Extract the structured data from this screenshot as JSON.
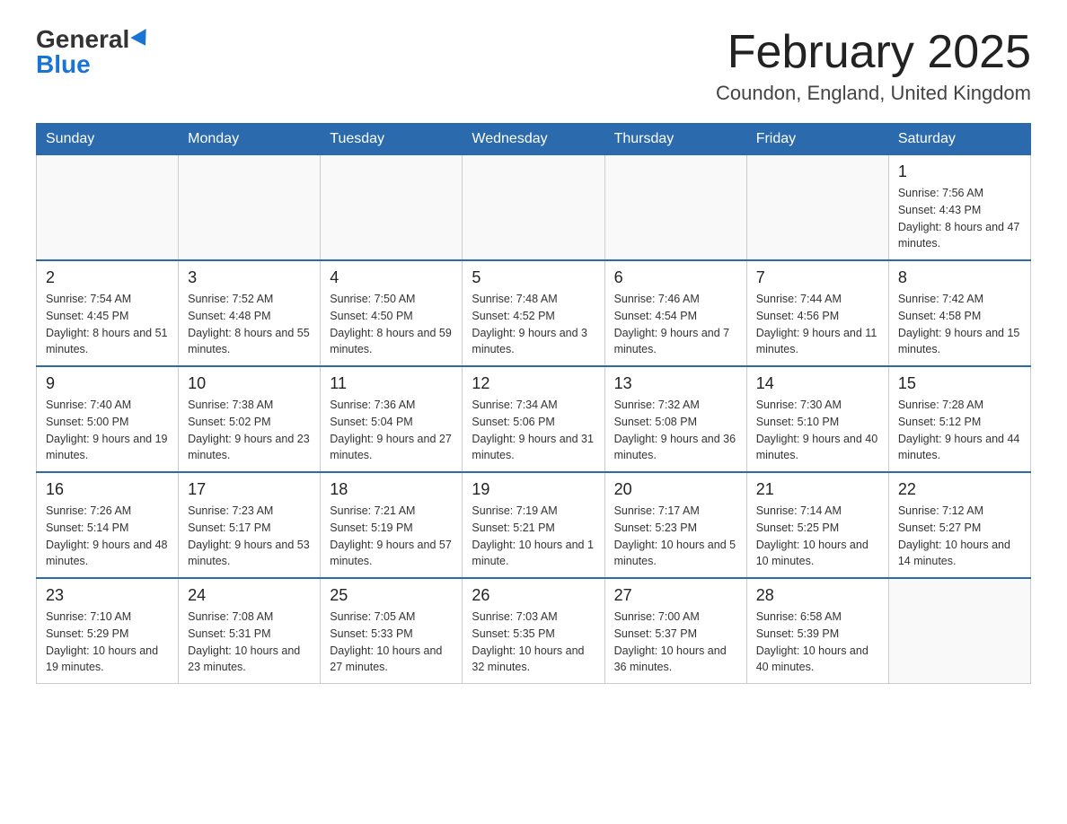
{
  "logo": {
    "general": "General",
    "blue": "Blue"
  },
  "header": {
    "title": "February 2025",
    "location": "Coundon, England, United Kingdom"
  },
  "weekdays": [
    "Sunday",
    "Monday",
    "Tuesday",
    "Wednesday",
    "Thursday",
    "Friday",
    "Saturday"
  ],
  "weeks": [
    [
      {
        "day": "",
        "info": ""
      },
      {
        "day": "",
        "info": ""
      },
      {
        "day": "",
        "info": ""
      },
      {
        "day": "",
        "info": ""
      },
      {
        "day": "",
        "info": ""
      },
      {
        "day": "",
        "info": ""
      },
      {
        "day": "1",
        "info": "Sunrise: 7:56 AM\nSunset: 4:43 PM\nDaylight: 8 hours and 47 minutes."
      }
    ],
    [
      {
        "day": "2",
        "info": "Sunrise: 7:54 AM\nSunset: 4:45 PM\nDaylight: 8 hours and 51 minutes."
      },
      {
        "day": "3",
        "info": "Sunrise: 7:52 AM\nSunset: 4:48 PM\nDaylight: 8 hours and 55 minutes."
      },
      {
        "day": "4",
        "info": "Sunrise: 7:50 AM\nSunset: 4:50 PM\nDaylight: 8 hours and 59 minutes."
      },
      {
        "day": "5",
        "info": "Sunrise: 7:48 AM\nSunset: 4:52 PM\nDaylight: 9 hours and 3 minutes."
      },
      {
        "day": "6",
        "info": "Sunrise: 7:46 AM\nSunset: 4:54 PM\nDaylight: 9 hours and 7 minutes."
      },
      {
        "day": "7",
        "info": "Sunrise: 7:44 AM\nSunset: 4:56 PM\nDaylight: 9 hours and 11 minutes."
      },
      {
        "day": "8",
        "info": "Sunrise: 7:42 AM\nSunset: 4:58 PM\nDaylight: 9 hours and 15 minutes."
      }
    ],
    [
      {
        "day": "9",
        "info": "Sunrise: 7:40 AM\nSunset: 5:00 PM\nDaylight: 9 hours and 19 minutes."
      },
      {
        "day": "10",
        "info": "Sunrise: 7:38 AM\nSunset: 5:02 PM\nDaylight: 9 hours and 23 minutes."
      },
      {
        "day": "11",
        "info": "Sunrise: 7:36 AM\nSunset: 5:04 PM\nDaylight: 9 hours and 27 minutes."
      },
      {
        "day": "12",
        "info": "Sunrise: 7:34 AM\nSunset: 5:06 PM\nDaylight: 9 hours and 31 minutes."
      },
      {
        "day": "13",
        "info": "Sunrise: 7:32 AM\nSunset: 5:08 PM\nDaylight: 9 hours and 36 minutes."
      },
      {
        "day": "14",
        "info": "Sunrise: 7:30 AM\nSunset: 5:10 PM\nDaylight: 9 hours and 40 minutes."
      },
      {
        "day": "15",
        "info": "Sunrise: 7:28 AM\nSunset: 5:12 PM\nDaylight: 9 hours and 44 minutes."
      }
    ],
    [
      {
        "day": "16",
        "info": "Sunrise: 7:26 AM\nSunset: 5:14 PM\nDaylight: 9 hours and 48 minutes."
      },
      {
        "day": "17",
        "info": "Sunrise: 7:23 AM\nSunset: 5:17 PM\nDaylight: 9 hours and 53 minutes."
      },
      {
        "day": "18",
        "info": "Sunrise: 7:21 AM\nSunset: 5:19 PM\nDaylight: 9 hours and 57 minutes."
      },
      {
        "day": "19",
        "info": "Sunrise: 7:19 AM\nSunset: 5:21 PM\nDaylight: 10 hours and 1 minute."
      },
      {
        "day": "20",
        "info": "Sunrise: 7:17 AM\nSunset: 5:23 PM\nDaylight: 10 hours and 5 minutes."
      },
      {
        "day": "21",
        "info": "Sunrise: 7:14 AM\nSunset: 5:25 PM\nDaylight: 10 hours and 10 minutes."
      },
      {
        "day": "22",
        "info": "Sunrise: 7:12 AM\nSunset: 5:27 PM\nDaylight: 10 hours and 14 minutes."
      }
    ],
    [
      {
        "day": "23",
        "info": "Sunrise: 7:10 AM\nSunset: 5:29 PM\nDaylight: 10 hours and 19 minutes."
      },
      {
        "day": "24",
        "info": "Sunrise: 7:08 AM\nSunset: 5:31 PM\nDaylight: 10 hours and 23 minutes."
      },
      {
        "day": "25",
        "info": "Sunrise: 7:05 AM\nSunset: 5:33 PM\nDaylight: 10 hours and 27 minutes."
      },
      {
        "day": "26",
        "info": "Sunrise: 7:03 AM\nSunset: 5:35 PM\nDaylight: 10 hours and 32 minutes."
      },
      {
        "day": "27",
        "info": "Sunrise: 7:00 AM\nSunset: 5:37 PM\nDaylight: 10 hours and 36 minutes."
      },
      {
        "day": "28",
        "info": "Sunrise: 6:58 AM\nSunset: 5:39 PM\nDaylight: 10 hours and 40 minutes."
      },
      {
        "day": "",
        "info": ""
      }
    ]
  ]
}
